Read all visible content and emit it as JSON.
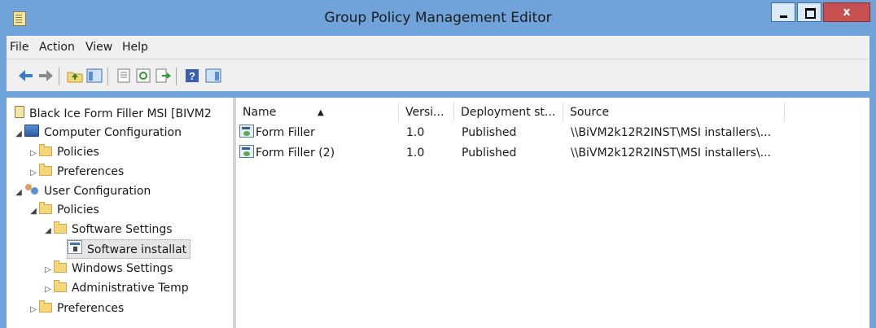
{
  "window": {
    "title": "Group Policy Management Editor",
    "close_glyph": "x"
  },
  "menu": [
    "File",
    "Action",
    "View",
    "Help"
  ],
  "tree": [
    {
      "label": "Black Ice Form Filler MSI [BIVM2",
      "icon": "doc-icon"
    },
    {
      "label": "Computer Configuration",
      "icon": "computer-icon",
      "twisty": "◢"
    },
    {
      "label": "Policies",
      "icon": "folder-icon",
      "twisty": "▷"
    },
    {
      "label": "Preferences",
      "icon": "folder-icon",
      "twisty": "▷"
    },
    {
      "label": "User Configuration",
      "icon": "users-icon",
      "twisty": "◢"
    },
    {
      "label": "Policies",
      "icon": "folder-icon",
      "twisty": "◢"
    },
    {
      "label": "Software Settings",
      "icon": "folder-icon",
      "twisty": "◢"
    },
    {
      "label": "Software installat",
      "icon": "software-installation-icon"
    },
    {
      "label": "Windows Settings",
      "icon": "folder-icon",
      "twisty": "▷"
    },
    {
      "label": "Administrative Temp",
      "icon": "folder-icon",
      "twisty": "▷"
    },
    {
      "label": "Preferences",
      "icon": "folder-icon",
      "twisty": "▷"
    }
  ],
  "list": {
    "columns": [
      "Name",
      "Versi...",
      "Deployment st...",
      "Source"
    ],
    "sort_indicator": "▲",
    "rows": [
      {
        "name": "Form Filler",
        "version": "1.0",
        "deployment": "Published",
        "source": "\\\\BiVM2k12R2INST\\MSI installers\\..."
      },
      {
        "name": "Form Filler (2)",
        "version": "1.0",
        "deployment": "Published",
        "source": "\\\\BiVM2k12R2INST\\MSI installers\\..."
      }
    ]
  },
  "toolbar_icons": [
    "back-arrow-icon",
    "forward-arrow-icon",
    "up-folder-icon",
    "show-hide-tree-icon",
    "properties-icon",
    "refresh-icon",
    "export-list-icon",
    "help-icon",
    "show-hide-action-pane-icon"
  ]
}
